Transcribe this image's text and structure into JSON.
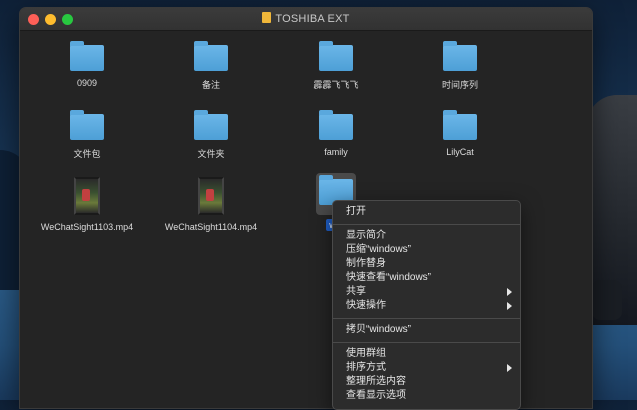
{
  "window": {
    "title": "TOSHIBA EXT"
  },
  "files": [
    {
      "name": "0909",
      "kind": "folder"
    },
    {
      "name": "备注",
      "kind": "folder"
    },
    {
      "name": "霹霹飞飞飞",
      "kind": "folder"
    },
    {
      "name": "时间序列",
      "kind": "folder"
    },
    {
      "name": "文件包",
      "kind": "folder"
    },
    {
      "name": "文件夹",
      "kind": "folder"
    },
    {
      "name": "family",
      "kind": "folder"
    },
    {
      "name": "LilyCat",
      "kind": "folder"
    },
    {
      "name": "WeChatSight1103.mp4",
      "kind": "video"
    },
    {
      "name": "WeChatSight1104.mp4",
      "kind": "video"
    },
    {
      "name": "win",
      "kind": "folder",
      "selected": true
    }
  ],
  "context_menu": {
    "open": "打开",
    "get_info": "显示简介",
    "compress": "压缩“windows”",
    "make_alias": "制作替身",
    "quick_look": "快速查看“windows”",
    "share": "共享",
    "quick_actions": "快速操作",
    "copy": "拷贝“windows”",
    "use_groups": "使用群组",
    "sort_by": "排序方式",
    "clean_up": "整理所选内容",
    "view_options": "查看显示选项"
  },
  "colors": {
    "accent": "#1f5fc9",
    "folder": "#5aa8dd",
    "window_bg": "#242424"
  }
}
